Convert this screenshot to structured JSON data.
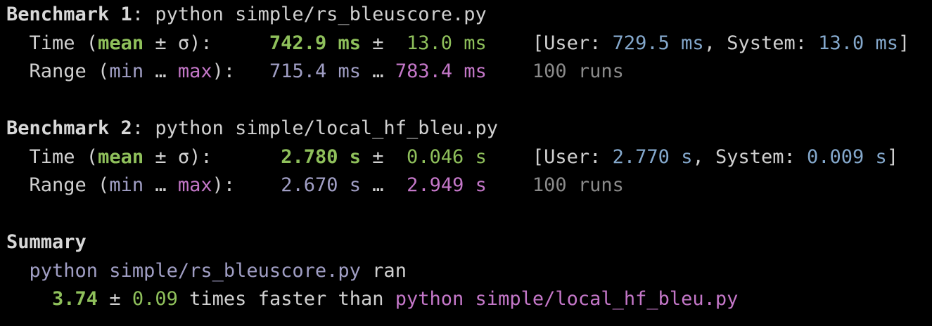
{
  "benchmarks": [
    {
      "heading": "Benchmark 1",
      "command": "python simple/rs_bleuscore.py",
      "time_label_pre": "Time (",
      "mean_label": "mean",
      "time_label_mid": " ± σ):",
      "mean_value": "742.9 ms",
      "pm": "±",
      "sigma_value": "13.0 ms",
      "user_label": "[User: ",
      "user_value": "729.5 ms",
      "system_label": ", System: ",
      "system_value": "13.0 ms",
      "close_bracket": "]",
      "range_label_pre": "Range (",
      "min_label": "min",
      "ellipsis": "…",
      "max_label": "max",
      "range_label_post": "):",
      "min_value": "715.4 ms",
      "max_value": "783.4 ms",
      "runs": "100 runs"
    },
    {
      "heading": "Benchmark 2",
      "command": "python simple/local_hf_bleu.py",
      "time_label_pre": "Time (",
      "mean_label": "mean",
      "time_label_mid": " ± σ):",
      "mean_value": "2.780 s",
      "pm": "±",
      "sigma_value": "0.046 s",
      "user_label": "[User: ",
      "user_value": "2.770 s",
      "system_label": ", System: ",
      "system_value": "0.009 s",
      "close_bracket": "]",
      "range_label_pre": "Range (",
      "min_label": "min",
      "ellipsis": "…",
      "max_label": "max",
      "range_label_post": "):",
      "min_value": "2.670 s",
      "max_value": "2.949 s",
      "runs": "100 runs"
    }
  ],
  "summary": {
    "heading": "Summary",
    "fastest_command": "python simple/rs_bleuscore.py",
    "ran": " ran",
    "factor": "3.74",
    "pm": "±",
    "factor_sigma": "0.09",
    "faster_text": "times faster than",
    "slower_command": "python simple/local_hf_bleu.py"
  },
  "colors": {
    "background": "#000000",
    "text": "#d0d0d0",
    "green": "#8fc05b",
    "blue": "#84a8cc",
    "lavender": "#a09ec4",
    "magenta": "#c477c8",
    "gray": "#8a8a8a"
  }
}
